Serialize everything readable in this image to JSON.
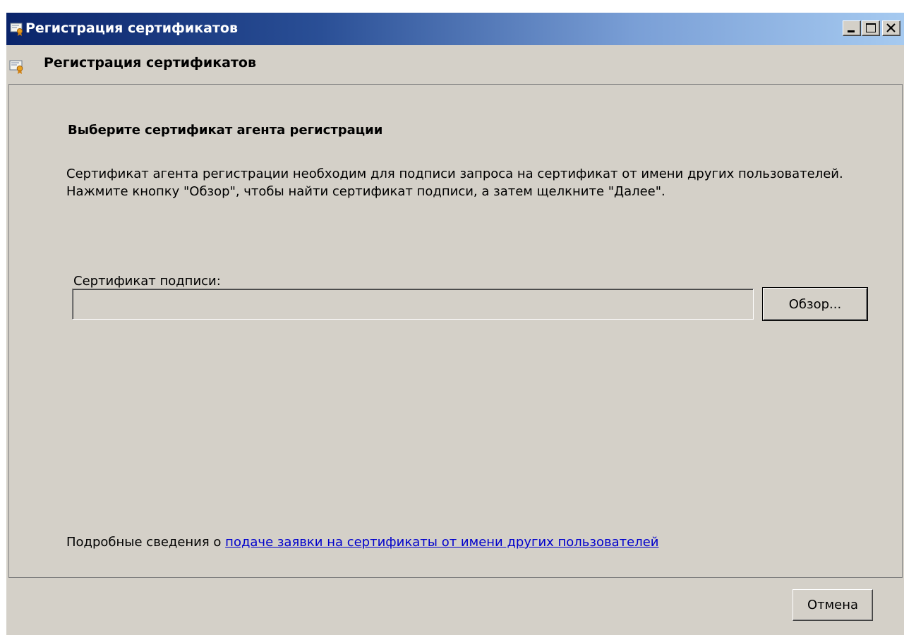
{
  "window": {
    "title": "Регистрация сертификатов",
    "icon": "certificate-icon",
    "controls": [
      "minimize-icon",
      "maximize-icon",
      "close-icon"
    ]
  },
  "header": {
    "title": "Регистрация сертификатов",
    "icon": "certificate-icon"
  },
  "main": {
    "heading": "Выберите сертификат агента регистрации",
    "description": "Сертификат агента регистрации необходим для подписи запроса на сертификат от имени других пользователей. Нажмите кнопку \"Обзор\", чтобы найти сертификат подписи, а затем щелкните \"Далее\".",
    "field_label": "Сертификат подписи:",
    "field_value": "",
    "browse_button": "Обзор...",
    "footer_prefix": "Подробные сведения о ",
    "footer_link": "подаче заявки на сертификаты от имени других пользователей"
  },
  "footer": {
    "cancel_button": "Отмена"
  },
  "colors": {
    "face": "#d4d0c8",
    "title_start": "#0a246a",
    "title_end": "#a6caf0",
    "link": "#0000cc"
  }
}
